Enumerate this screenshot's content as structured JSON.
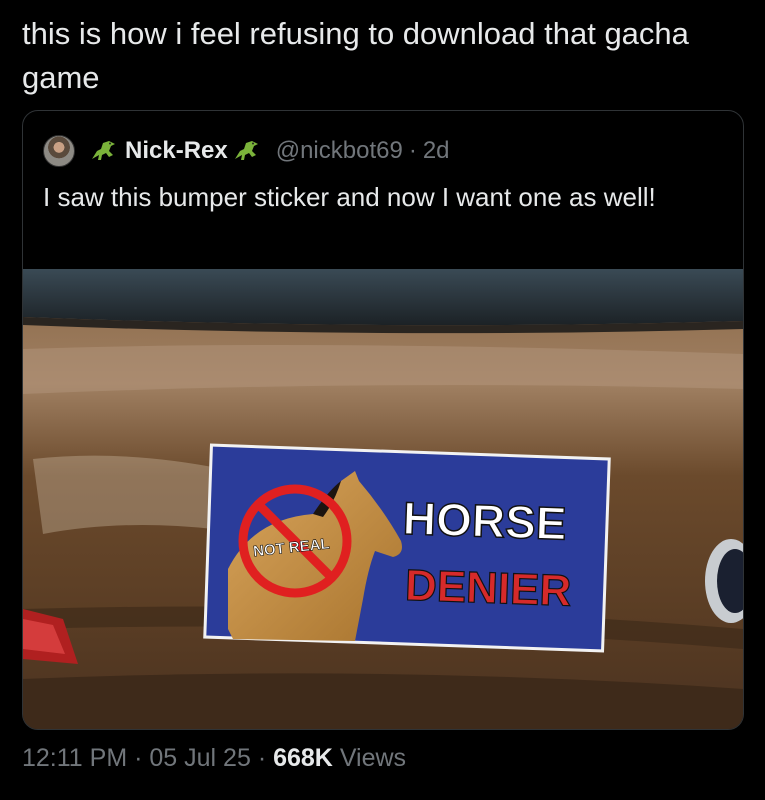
{
  "post": {
    "text": "this is how i feel refusing to download that gacha game"
  },
  "quoted_post": {
    "display_name": "Nick-Rex",
    "handle": "@nickbot69",
    "separator": "·",
    "age": "2d",
    "text": "I saw this bumper sticker and now I want one as well!",
    "icons": [
      "avatar",
      "dinosaur-emoji-icon",
      "dinosaur-emoji-icon"
    ]
  },
  "photo": {
    "sticker": {
      "stamp_text": "NOT REAL",
      "line1": "HORSE",
      "line2": "DENIER"
    },
    "colors": {
      "car_paint": "#6b4a2c",
      "sticker_bg": "#2b3c9a",
      "horse_text": "#ffffff",
      "denier_text": "#d62a2a",
      "prohibition": "#e02020"
    }
  },
  "footer": {
    "time": "12:11 PM",
    "date": "05 Jul 25",
    "views_count": "668K",
    "views_label": "Views",
    "separator": "·"
  }
}
